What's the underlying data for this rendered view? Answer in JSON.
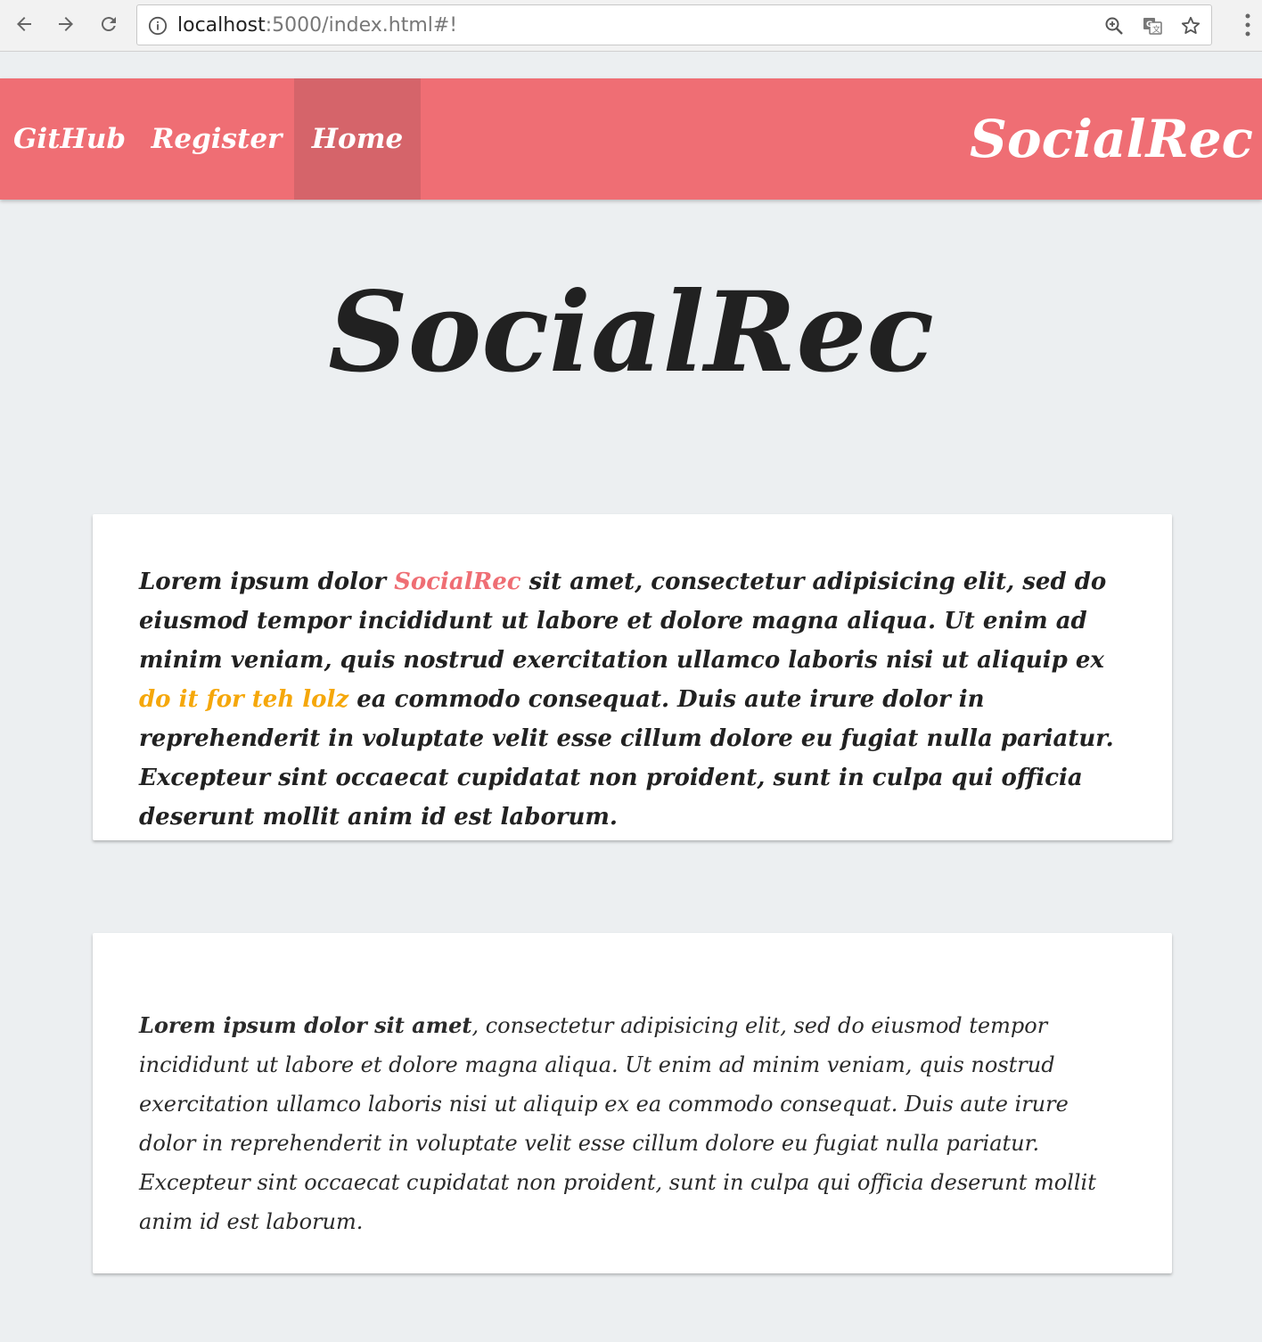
{
  "browser": {
    "url_host": "localhost",
    "url_rest": ":5000/index.html#!",
    "icons": [
      "back-arrow-icon",
      "forward-arrow-icon",
      "reload-icon",
      "info-icon",
      "zoom-icon",
      "translate-icon",
      "star-icon",
      "menu-icon"
    ]
  },
  "nav": {
    "items": [
      {
        "label": "GitHub"
      },
      {
        "label": "Register"
      },
      {
        "label": "Home",
        "active": true
      }
    ],
    "brand": "SocialRec",
    "color": "#ef6e74",
    "active_color": "#d5646a"
  },
  "hero": {
    "title": "SocialRec"
  },
  "card1": {
    "part1": "Lorem ipsum dolor ",
    "highlight1": "SocialRec",
    "part2": " sit amet, consectetur adipisicing elit, sed do eiusmod tempor incididunt ut labore et dolore magna aliqua. Ut enim ad minim veniam, quis nostrud exercitation ullamco laboris nisi ut aliquip ex ",
    "highlight2": "do it for teh lolz",
    "part3": " ea commodo consequat. Duis aute irure dolor in reprehenderit in voluptate velit esse cillum dolore eu fugiat nulla pariatur. Excepteur sint occaecat cupidatat non proident, sunt in culpa qui officia deserunt mollit anim id est laborum.",
    "highlight1_color": "#ef6e74",
    "highlight2_color": "#f5a70a"
  },
  "card2": {
    "strong": "Lorem ipsum dolor sit amet",
    "rest": ", consectetur adipisicing elit, sed do eiusmod tempor incididunt ut labore et dolore magna aliqua. Ut enim ad minim veniam, quis nostrud exercitation ullamco laboris nisi ut aliquip ex ea commodo consequat. Duis aute irure dolor in reprehenderit in voluptate velit esse cillum dolore eu fugiat nulla pariatur. Excepteur sint occaecat cupidatat non proident, sunt in culpa qui officia deserunt mollit anim id est laborum."
  }
}
